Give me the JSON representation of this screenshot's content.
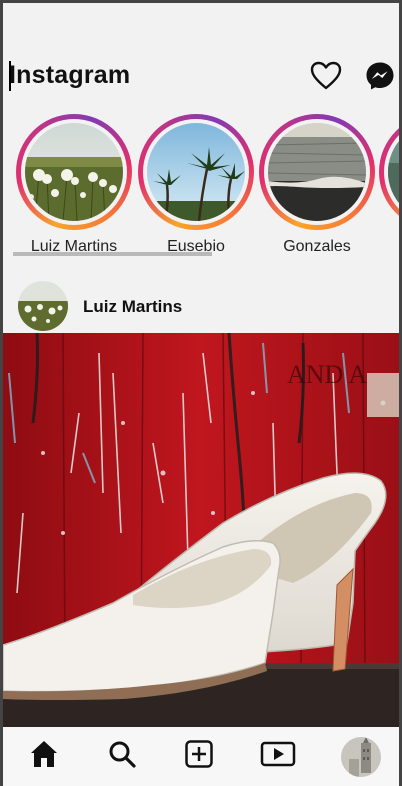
{
  "app": {
    "title": "Instagram"
  },
  "header": {
    "icons": [
      "heart-icon",
      "messenger-icon"
    ]
  },
  "stories": [
    {
      "name": "Luiz Martins",
      "photo": "dandelion-field"
    },
    {
      "name": "Eusebio",
      "photo": "palm-trees"
    },
    {
      "name": "Gonzales",
      "photo": "ocean-shore"
    },
    {
      "name": "",
      "photo": "partial-story"
    }
  ],
  "post": {
    "username": "Luiz Martins",
    "avatar": "dandelion-field",
    "image": "white-heels-red-wall",
    "wall_text": "AND A"
  },
  "bottom_nav": {
    "items": [
      "home-icon",
      "search-icon",
      "add-post-icon",
      "reels-icon",
      "profile-avatar"
    ]
  },
  "colors": {
    "background": "#f2f2f2",
    "ring_start": "#f7a42b",
    "ring_mid": "#e1306c",
    "ring_end": "#833ab4",
    "wall_red": "#b5121b"
  }
}
